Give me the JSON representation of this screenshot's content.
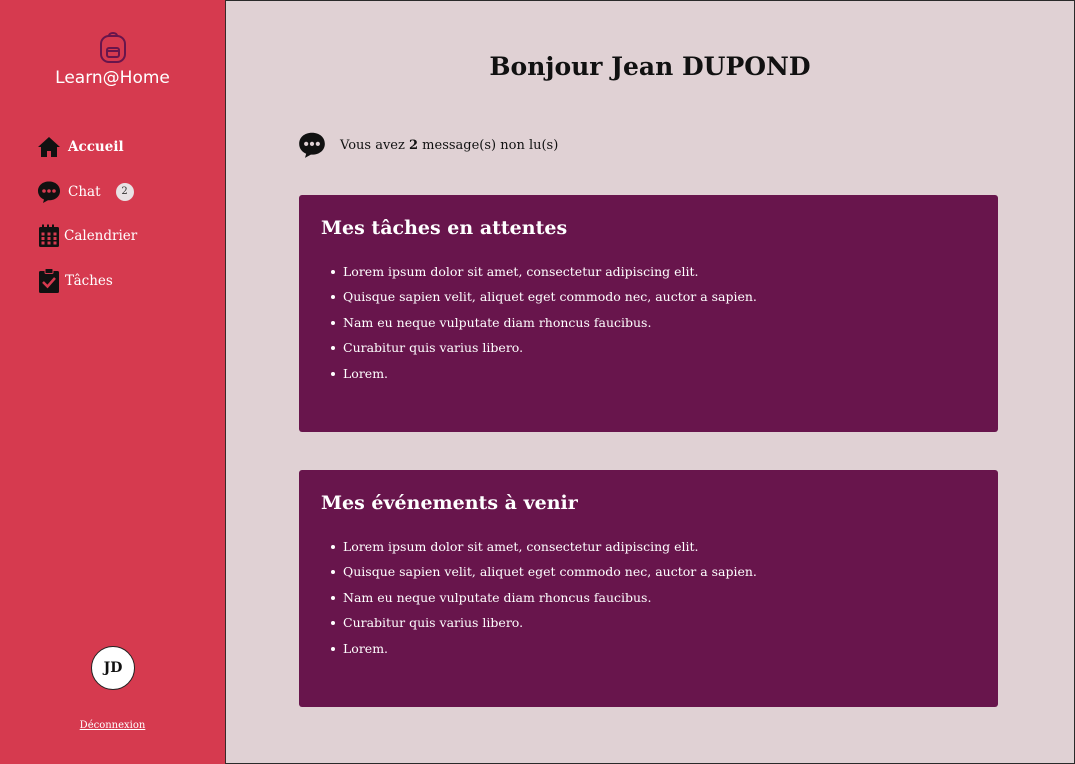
{
  "brand": {
    "name": "Learn@Home",
    "icon": "backpack-icon"
  },
  "nav": {
    "items": [
      {
        "label": "Accueil",
        "icon": "home-icon",
        "active": true
      },
      {
        "label": "Chat",
        "icon": "chat-icon",
        "badge": "2"
      },
      {
        "label": "Calendrier",
        "icon": "calendar-icon"
      },
      {
        "label": "Tâches",
        "icon": "clipboard-check-icon"
      }
    ]
  },
  "user": {
    "initials": "JD",
    "logout_label": "Déconnexion"
  },
  "main": {
    "greeting": "Bonjour Jean DUPOND",
    "messages": {
      "prefix": "Vous avez",
      "count": "2",
      "suffix": "message(s) non lu(s)"
    }
  },
  "cards": [
    {
      "title": "Mes tâches en attentes",
      "items": [
        "Lorem ipsum dolor sit amet, consectetur adipiscing elit.",
        "Quisque sapien velit, aliquet eget commodo nec, auctor a sapien.",
        "Nam eu neque vulputate diam rhoncus faucibus.",
        "Curabitur quis varius libero.",
        "Lorem."
      ]
    },
    {
      "title": "Mes événements à venir",
      "items": [
        "Lorem ipsum dolor sit amet, consectetur adipiscing elit.",
        "Quisque sapien velit, aliquet eget commodo nec, auctor a sapien.",
        "Nam eu neque vulputate diam rhoncus faucibus.",
        "Curabitur quis varius libero.",
        "Lorem."
      ]
    }
  ],
  "colors": {
    "sidebar": "#d63a4f",
    "background": "#e0d1d4",
    "card": "#68154c",
    "brand_icon": "#68154c"
  }
}
